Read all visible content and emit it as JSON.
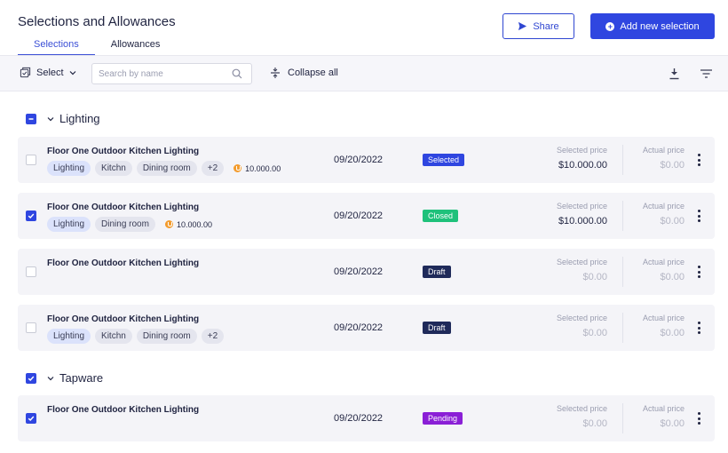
{
  "header": {
    "title": "Selections and Allowances",
    "tabs": [
      "Selections",
      "Allowances"
    ],
    "share_label": "Share",
    "add_label": "Add new selection"
  },
  "toolbar": {
    "select_label": "Select",
    "search_placeholder": "Search by name",
    "collapse_label": "Collapse all"
  },
  "colors": {
    "accent": "#2f46e0",
    "selected": "#2f46e0",
    "closed": "#1fc17b",
    "draft": "#1f2a5a",
    "pending": "#8a1fd6"
  },
  "groups": [
    {
      "name": "Lighting",
      "state": "indeterminate",
      "rows": [
        {
          "title": "Floor One Outdoor Kitchen Lighting",
          "checked": false,
          "tags": [
            "Lighting",
            "Kitchn",
            "Dining room",
            "+2"
          ],
          "amount": "10.000.00",
          "date": "09/20/2022",
          "status": "Selected",
          "selected_price_label": "Selected price",
          "selected_price": "$10.000.00",
          "actual_price_label": "Actual price",
          "actual_price": "$0.00"
        },
        {
          "title": "Floor One Outdoor Kitchen Lighting",
          "checked": true,
          "tags": [
            "Lighting",
            "Dining room"
          ],
          "amount": "10.000.00",
          "date": "09/20/2022",
          "status": "Closed",
          "selected_price_label": "Selected price",
          "selected_price": "$10.000.00",
          "actual_price_label": "Actual price",
          "actual_price": "$0.00"
        },
        {
          "title": "Floor One Outdoor Kitchen Lighting",
          "checked": false,
          "tags": [],
          "amount": "",
          "date": "09/20/2022",
          "status": "Draft",
          "selected_price_label": "Selected price",
          "selected_price": "$0.00",
          "actual_price_label": "Actual price",
          "actual_price": "$0.00"
        },
        {
          "title": "Floor One Outdoor Kitchen Lighting",
          "checked": false,
          "tags": [
            "Lighting",
            "Kitchn",
            "Dining room",
            "+2"
          ],
          "amount": "",
          "date": "09/20/2022",
          "status": "Draft",
          "selected_price_label": "Selected price",
          "selected_price": "$0.00",
          "actual_price_label": "Actual price",
          "actual_price": "$0.00"
        }
      ]
    },
    {
      "name": "Tapware",
      "state": "checked",
      "rows": [
        {
          "title": "Floor One Outdoor Kitchen Lighting",
          "checked": true,
          "tags": [],
          "amount": "",
          "date": "09/20/2022",
          "status": "Pending",
          "selected_price_label": "Selected price",
          "selected_price": "$0.00",
          "actual_price_label": "Actual price",
          "actual_price": "$0.00"
        }
      ]
    }
  ]
}
